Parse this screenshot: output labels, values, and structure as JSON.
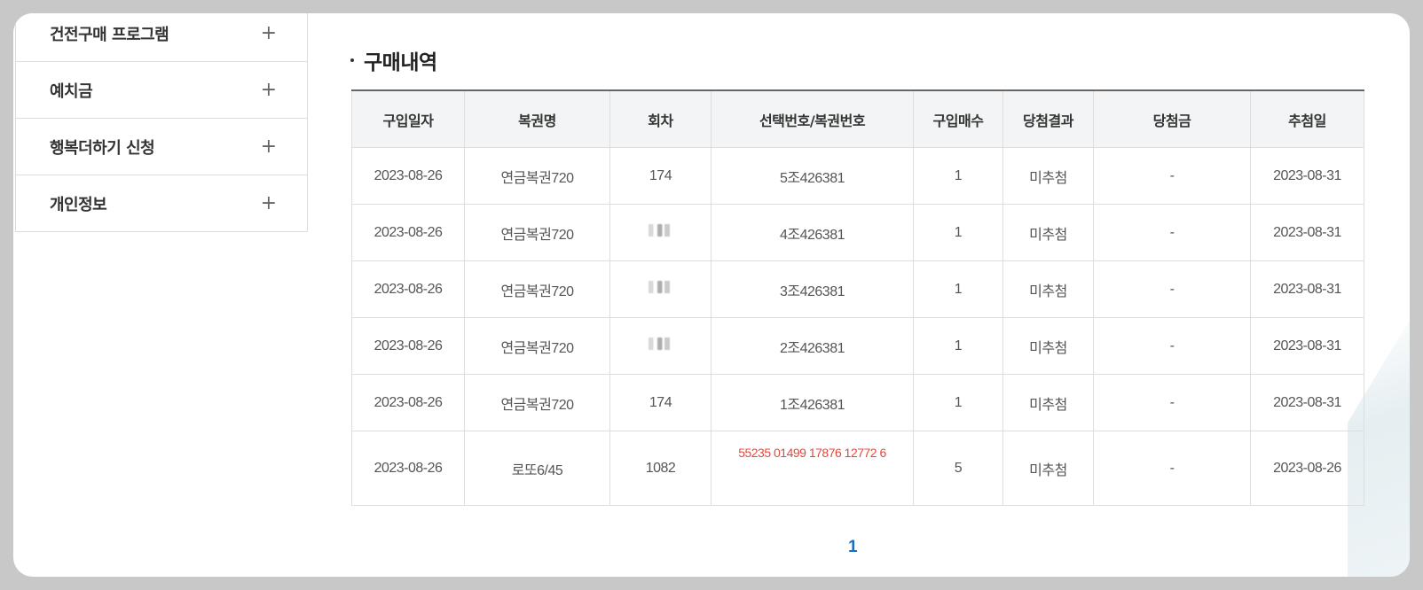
{
  "sidebar": {
    "items": [
      {
        "label": "건전구매 프로그램",
        "icon": "+"
      },
      {
        "label": "예치금",
        "icon": "+"
      },
      {
        "label": "행복더하기 신청",
        "icon": "+"
      },
      {
        "label": "개인정보",
        "icon": "+"
      }
    ]
  },
  "section": {
    "title": "구매내역"
  },
  "table": {
    "headers": [
      "구입일자",
      "복권명",
      "회차",
      "선택번호/복권번호",
      "구입매수",
      "당첨결과",
      "당첨금",
      "추첨일"
    ],
    "rows": [
      [
        "2023-08-26",
        "연금복권720",
        "174",
        "5조426381",
        "1",
        "미추첨",
        "-",
        "2023-08-31"
      ],
      [
        "2023-08-26",
        "연금복권720",
        "",
        "4조426381",
        "1",
        "미추첨",
        "-",
        "2023-08-31"
      ],
      [
        "2023-08-26",
        "연금복권720",
        "",
        "3조426381",
        "1",
        "미추첨",
        "-",
        "2023-08-31"
      ],
      [
        "2023-08-26",
        "연금복권720",
        "",
        "2조426381",
        "1",
        "미추첨",
        "-",
        "2023-08-31"
      ],
      [
        "2023-08-26",
        "연금복권720",
        "174",
        "1조426381",
        "1",
        "미추첨",
        "-",
        "2023-08-31"
      ],
      [
        "2023-08-26",
        "로또6/45",
        "1082",
        "55235 01499 17876 12772 6",
        "5",
        "미추첨",
        "-",
        "2023-08-26"
      ]
    ]
  },
  "pagination": {
    "current": "1"
  },
  "colors": {
    "accent_link": "#1b6fc2",
    "highlight_red": "#e8453c",
    "table_border": "#dedede"
  }
}
